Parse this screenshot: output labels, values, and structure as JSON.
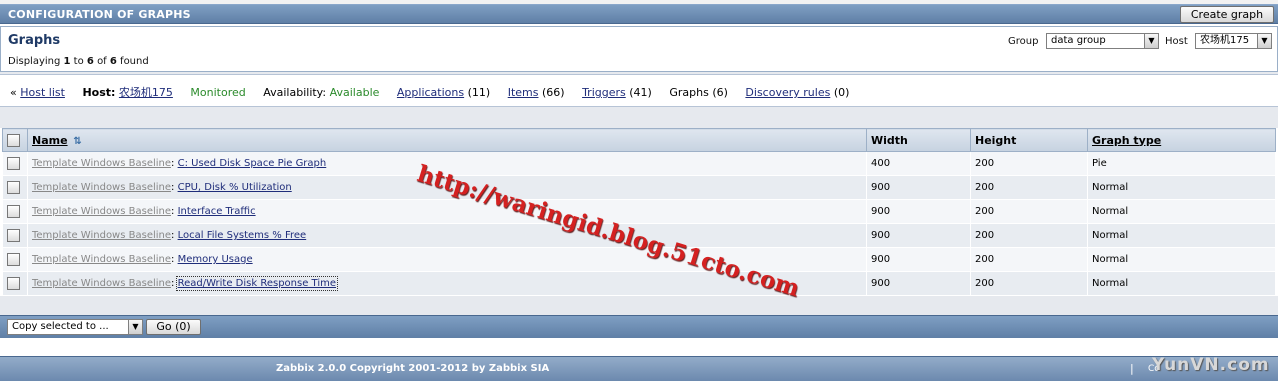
{
  "header": {
    "title": "CONFIGURATION OF GRAPHS",
    "create_button": "Create graph"
  },
  "graphs_box": {
    "heading": "Graphs",
    "found_prefix": "Displaying",
    "found_from": "1",
    "found_to_word": "to",
    "found_to": "6",
    "found_of_word": "of",
    "found_total": "6",
    "found_suffix": "found",
    "group_label": "Group",
    "group_value": "data group",
    "host_label": "Host",
    "host_value": "农场机175"
  },
  "nav": {
    "laquo": "«",
    "host_list": "Host list",
    "host_label": "Host:",
    "host_name": "农场机175",
    "status": "Monitored",
    "availability_label": "Availability:",
    "availability_value": "Available",
    "applications": "Applications",
    "applications_count": "(11)",
    "items": "Items",
    "items_count": "(66)",
    "triggers": "Triggers",
    "triggers_count": "(41)",
    "graphs": "Graphs",
    "graphs_count": "(6)",
    "discovery": "Discovery rules",
    "discovery_count": "(0)"
  },
  "table": {
    "columns": {
      "name": "Name",
      "width": "Width",
      "height": "Height",
      "type": "Graph type"
    },
    "rows": [
      {
        "template": "Template Windows Baseline",
        "sep": ":",
        "name": "C: Used Disk Space Pie Graph",
        "width": "400",
        "height": "200",
        "type": "Pie"
      },
      {
        "template": "Template Windows Baseline",
        "sep": ":",
        "name": "CPU, Disk % Utilization",
        "width": "900",
        "height": "200",
        "type": "Normal"
      },
      {
        "template": "Template Windows Baseline",
        "sep": ":",
        "name": "Interface Traffic",
        "width": "900",
        "height": "200",
        "type": "Normal"
      },
      {
        "template": "Template Windows Baseline",
        "sep": ":",
        "name": "Local File Systems % Free",
        "width": "900",
        "height": "200",
        "type": "Normal"
      },
      {
        "template": "Template Windows Baseline",
        "sep": ":",
        "name": "Memory Usage",
        "width": "900",
        "height": "200",
        "type": "Normal"
      },
      {
        "template": "Template Windows Baseline",
        "sep": ":",
        "name": "Read/Write Disk Response Time",
        "width": "900",
        "height": "200",
        "type": "Normal"
      }
    ]
  },
  "actions": {
    "select_value": "Copy selected to ...",
    "go_button": "Go (0)"
  },
  "footer": {
    "copyright": "Zabbix 2.0.0 Copyright 2001-2012 by Zabbix SIA",
    "separator": "|",
    "right_small": "Co",
    "site_mark": "YunVN.com"
  },
  "watermark": "http://waringid.blog.51cto.com"
}
